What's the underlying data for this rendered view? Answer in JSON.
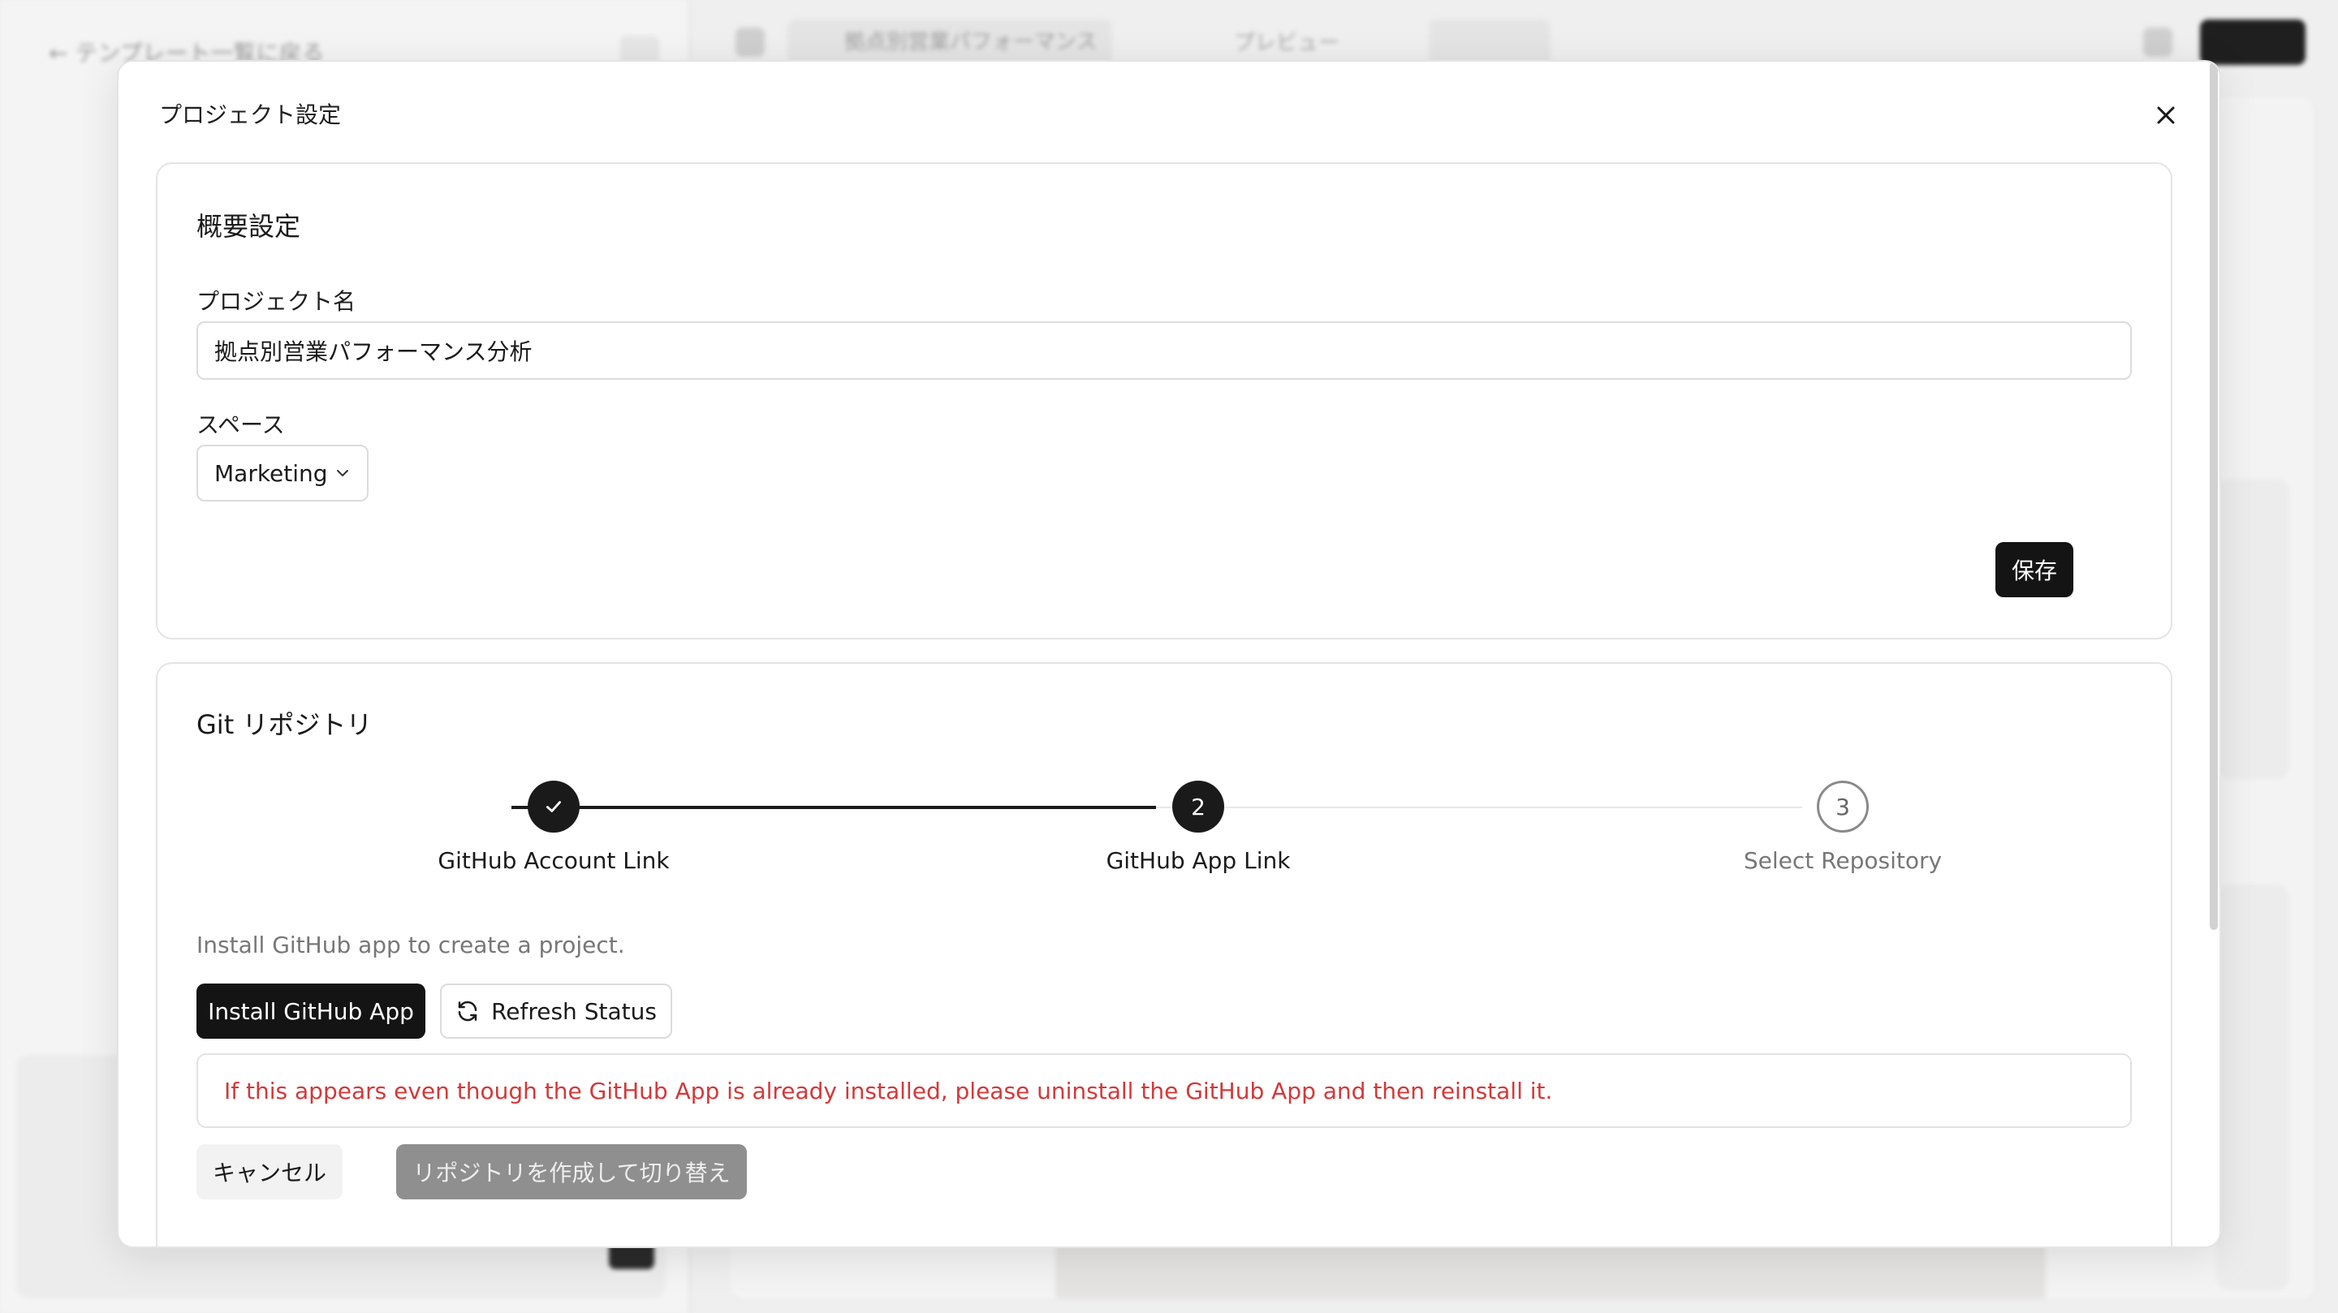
{
  "background": {
    "back_label": "← テンプレート一覧に戻る",
    "tab_label": "拠点別営業パフォーマンス分析",
    "preview_label": "プレビュー"
  },
  "modal": {
    "title": "プロジェクト設定",
    "close_icon": "close-icon"
  },
  "overview": {
    "title": "概要設定",
    "project_name_label": "プロジェクト名",
    "project_name_value": "拠点別営業パフォーマンス分析",
    "space_label": "スペース",
    "space_value": "Marketing",
    "save_label": "保存"
  },
  "git": {
    "title": "Git リポジトリ",
    "steps": [
      {
        "number": "1",
        "label": "GitHub Account Link",
        "status": "done"
      },
      {
        "number": "2",
        "label": "GitHub App Link",
        "status": "current"
      },
      {
        "number": "3",
        "label": "Select Repository",
        "status": "pending"
      }
    ],
    "hint": "Install GitHub app to create a project.",
    "install_label": "Install GitHub App",
    "refresh_label": "Refresh Status",
    "alert": "If this appears even though the GitHub App is already installed, please uninstall the GitHub App and then reinstall it.",
    "cancel_label": "キャンセル",
    "create_label": "リポジトリを作成して切り替え"
  },
  "colors": {
    "primary": "#141414",
    "error": "#d2393a",
    "disabled": "#8f8f8f"
  }
}
